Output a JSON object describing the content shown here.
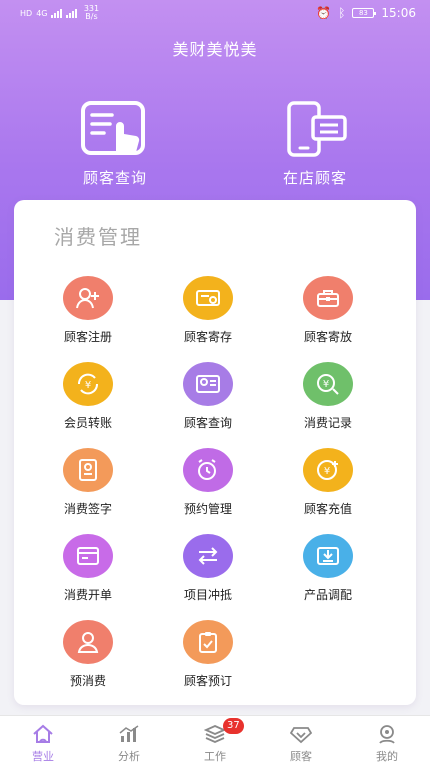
{
  "status_bar": {
    "sim_label": "HD",
    "network": "4G",
    "speed": "331 B/s",
    "time": "15:06",
    "battery": "83"
  },
  "header": {
    "title": "美财美悦美"
  },
  "hero_actions": [
    {
      "label": "顾客查询",
      "icon": "customer-search-icon"
    },
    {
      "label": "在店顾客",
      "icon": "in-store-customer-icon"
    }
  ],
  "section": {
    "title": "消费管理",
    "items": [
      {
        "label": "顾客注册",
        "icon": "customer-register-icon",
        "color": "#f07f6c"
      },
      {
        "label": "顾客寄存",
        "icon": "customer-deposit-icon",
        "color": "#f3b21c"
      },
      {
        "label": "顾客寄放",
        "icon": "customer-storage-icon",
        "color": "#f07f6c"
      },
      {
        "label": "会员转账",
        "icon": "member-transfer-icon",
        "color": "#f3b21c"
      },
      {
        "label": "顾客查询",
        "icon": "customer-query-icon",
        "color": "#a77ce6"
      },
      {
        "label": "消费记录",
        "icon": "consumption-record-icon",
        "color": "#6fc06a"
      },
      {
        "label": "消费签字",
        "icon": "consumption-sign-icon",
        "color": "#f39a5a"
      },
      {
        "label": "预约管理",
        "icon": "appointment-icon",
        "color": "#c06be6"
      },
      {
        "label": "顾客充值",
        "icon": "customer-recharge-icon",
        "color": "#f3b21c"
      },
      {
        "label": "消费开单",
        "icon": "create-order-icon",
        "color": "#c86be8"
      },
      {
        "label": "项目冲抵",
        "icon": "project-offset-icon",
        "color": "#9a6cec"
      },
      {
        "label": "产品调配",
        "icon": "product-allocate-icon",
        "color": "#49b0e8"
      },
      {
        "label": "预消费",
        "icon": "pre-consume-icon",
        "color": "#f07f6c"
      },
      {
        "label": "顾客预订",
        "icon": "customer-booking-icon",
        "color": "#f39a5a"
      }
    ]
  },
  "tabbar": {
    "active_color": "#a67ce6",
    "tabs": [
      {
        "label": "营业",
        "icon": "home-icon",
        "active": true
      },
      {
        "label": "分析",
        "icon": "analysis-icon",
        "active": false
      },
      {
        "label": "工作",
        "icon": "work-icon",
        "active": false,
        "badge": "37"
      },
      {
        "label": "顾客",
        "icon": "customer-icon",
        "active": false
      },
      {
        "label": "我的",
        "icon": "profile-icon",
        "active": false
      }
    ]
  }
}
